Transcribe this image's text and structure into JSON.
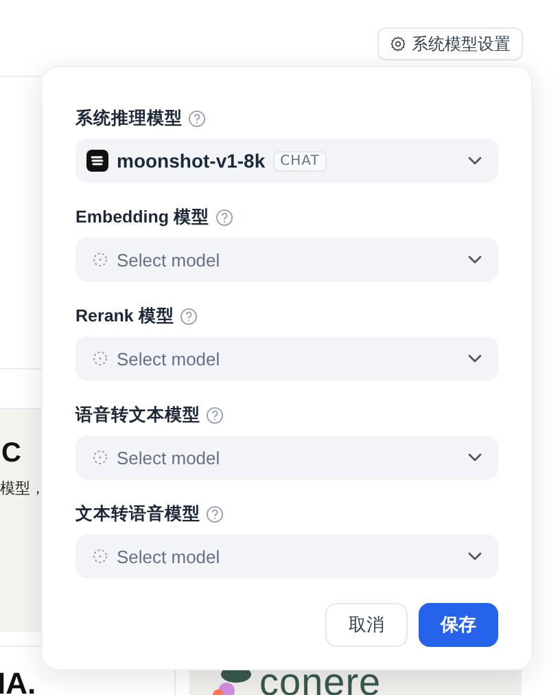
{
  "settings_button": {
    "label": "系统模型设置"
  },
  "panel": {
    "fields": [
      {
        "label": "系统推理模型",
        "value": "moonshot-v1-8k",
        "tag": "CHAT"
      },
      {
        "label": "Embedding 模型",
        "placeholder": "Select model"
      },
      {
        "label": "Rerank 模型",
        "placeholder": "Select model"
      },
      {
        "label": "语音转文本模型",
        "placeholder": "Select model"
      },
      {
        "label": "文本转语音模型",
        "placeholder": "Select model"
      }
    ],
    "cancel_button": "取消",
    "save_button": "保存"
  },
  "background": {
    "card_title": "C",
    "card_text": "模型，",
    "bottom_left_logo": "IA.",
    "bottom_right_logo": "conere"
  }
}
